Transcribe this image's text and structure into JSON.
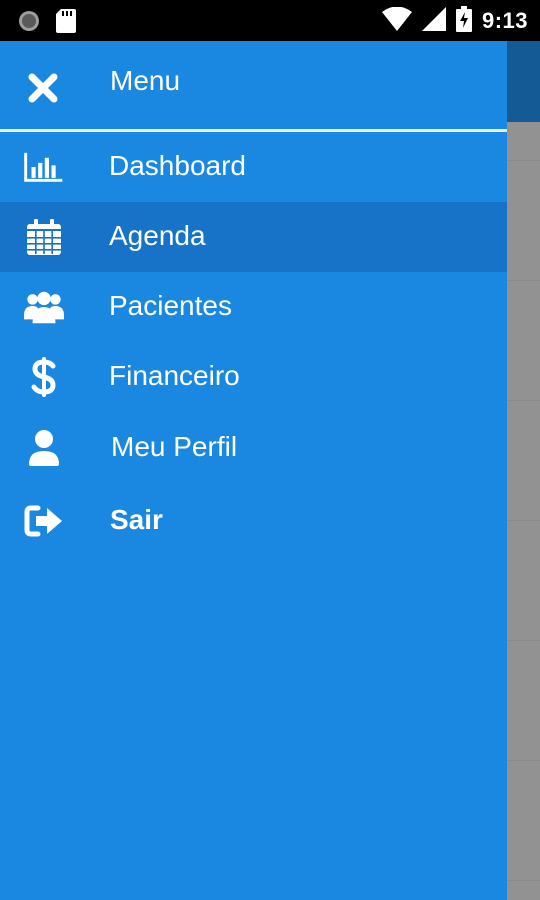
{
  "status_bar": {
    "time": "9:13",
    "icons": [
      "notification-dot-icon",
      "sd-card-icon",
      "wifi-icon",
      "cellular-signal-icon",
      "battery-charging-icon"
    ]
  },
  "drawer": {
    "title": "Menu",
    "close_icon": "close-icon",
    "background_color": "#1a88e0",
    "active_item_color": "#1773c8",
    "items": [
      {
        "label": "Dashboard",
        "icon": "bar-chart-icon",
        "active": false
      },
      {
        "label": "Agenda",
        "icon": "calendar-icon",
        "active": true
      },
      {
        "label": "Pacientes",
        "icon": "users-icon",
        "active": false
      },
      {
        "label": "Financeiro",
        "icon": "dollar-icon",
        "active": false
      },
      {
        "label": "Meu Perfil",
        "icon": "user-icon",
        "active": false
      },
      {
        "label": "Sair",
        "icon": "sign-out-icon",
        "active": false
      }
    ]
  }
}
